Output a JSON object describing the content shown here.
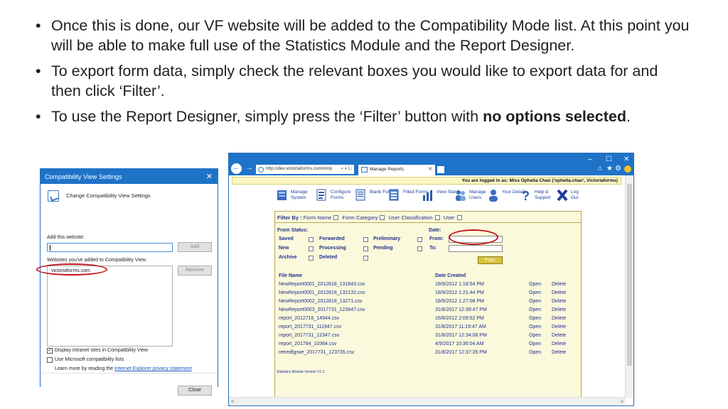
{
  "slide": {
    "bullets": [
      {
        "text": "Once this is done, our VF website will be added to the Compatibility Mode list. At this point you will be able to make full use of the Statistics Module and the Report Designer."
      },
      {
        "text": "To export form data, simply check the relevant boxes you would like to export data for and then click ‘Filter’."
      },
      {
        "text": "To use the Report Designer, simply press the ‘Filter’ button with ",
        "bold": "no options selected",
        "after": "."
      }
    ]
  },
  "compat_dialog": {
    "title": "Compatibility View Settings",
    "close": "✕",
    "heading": "Change Compatibility View Settings",
    "add_label": "Add this website:",
    "add_value": "",
    "add_button": "Add",
    "list_label": "Websites you've added to Compatibility View:",
    "list_items": [
      "victoriaforms.com"
    ],
    "remove_button": "Remove",
    "options": [
      {
        "label": "Display intranet sites in Compatibility View",
        "checked": true
      },
      {
        "label": "Use Microsoft compatibility lists",
        "checked": false
      }
    ],
    "learn_more": "Learn more by reading the",
    "privacy_link": "Internet Explorer privacy statement",
    "close_button": "Close",
    "highlight_color": "#c0141c"
  },
  "browser": {
    "window_controls": [
      "–",
      "☐",
      "✕"
    ],
    "back": "←",
    "forward": "→",
    "address": "http://dev.victoriaforms.com/vmp",
    "address_icons": "⌕ ▾ ↻",
    "tab_title": "Manage Reports",
    "tab_close": "✕",
    "toolbar_icons": {
      "home": "⌂",
      "favorites": "★",
      "settings": "⚙"
    },
    "logged_in": "You are logged in as: Miss Ophelia Chan ('ophelia.chan', Victoriaforms)",
    "menu": [
      {
        "icon": "manage-system-icon",
        "label": "Manage System"
      },
      {
        "icon": "configure-forms-icon",
        "label": "Configure Forms"
      },
      {
        "icon": "blank-forms-icon",
        "label": "Blank Forms"
      },
      {
        "icon": "filled-forms-icon",
        "label": "Filled Forms"
      },
      {
        "icon": "view-stats-icon",
        "label": "View Stats"
      },
      {
        "icon": "manage-users-icon",
        "label": "Manage Users"
      },
      {
        "icon": "your-details-icon",
        "label": "Your Details"
      },
      {
        "icon": "help-support-icon",
        "label": "Help & Support"
      },
      {
        "icon": "log-out-icon",
        "label": "Log Out"
      }
    ],
    "filter_by": {
      "label": "Filter By :",
      "options": [
        "Form Name",
        "Form Category",
        "User Classification",
        "User"
      ]
    },
    "from_status": {
      "label": "From Status:",
      "statuses": [
        [
          "Saved",
          "Forwarded",
          "Preliminary"
        ],
        [
          "New",
          "Processing",
          "Pending"
        ],
        [
          "Archive",
          "Deleted"
        ]
      ]
    },
    "date": {
      "label": "Date:",
      "from_label": "From:",
      "to_label": "To:",
      "from_value": "",
      "to_value": ""
    },
    "filter_button": "Filter",
    "files": {
      "col_name": "File Name",
      "col_date": "Date Created",
      "open": "Open",
      "delete": "Delete",
      "rows": [
        {
          "name": "NewReport0001_2012818_131843.csv",
          "date": "18/9/2012 1:18:54 PM"
        },
        {
          "name": "NewReport0001_2012818_132132.csv",
          "date": "18/9/2012 1:21:44 PM"
        },
        {
          "name": "NewReport0002_2012818_13271.csv",
          "date": "18/9/2012 1:27:08 PM"
        },
        {
          "name": "NewReport0003_2017731_123947.csv",
          "date": "31/8/2017 12:39:47 PM"
        },
        {
          "name": "report_2012716_14944.csv",
          "date": "16/8/2012 2:09:52 PM"
        },
        {
          "name": "report_2017731_111947.csv",
          "date": "31/8/2017 11:19:47 AM"
        },
        {
          "name": "report_2017731_12347.csv",
          "date": "31/8/2017 12:34:08 PM"
        },
        {
          "name": "report_201784_10364.csv",
          "date": "4/9/2017 10:36:04 AM"
        },
        {
          "name": "retredfgrwe_2017731_123735.csv",
          "date": "31/8/2017 12:37:35 PM"
        }
      ]
    },
    "version": "Statistics Module Version V1.1",
    "scroll_left": "<",
    "scroll_right": ">"
  },
  "colors": {
    "titlebar": "#1e73c8",
    "panel_bg": "#fbf9dc",
    "panel_text": "#1f2f8c",
    "filter_button": "#d9c33c",
    "highlight": "#c0141c"
  }
}
